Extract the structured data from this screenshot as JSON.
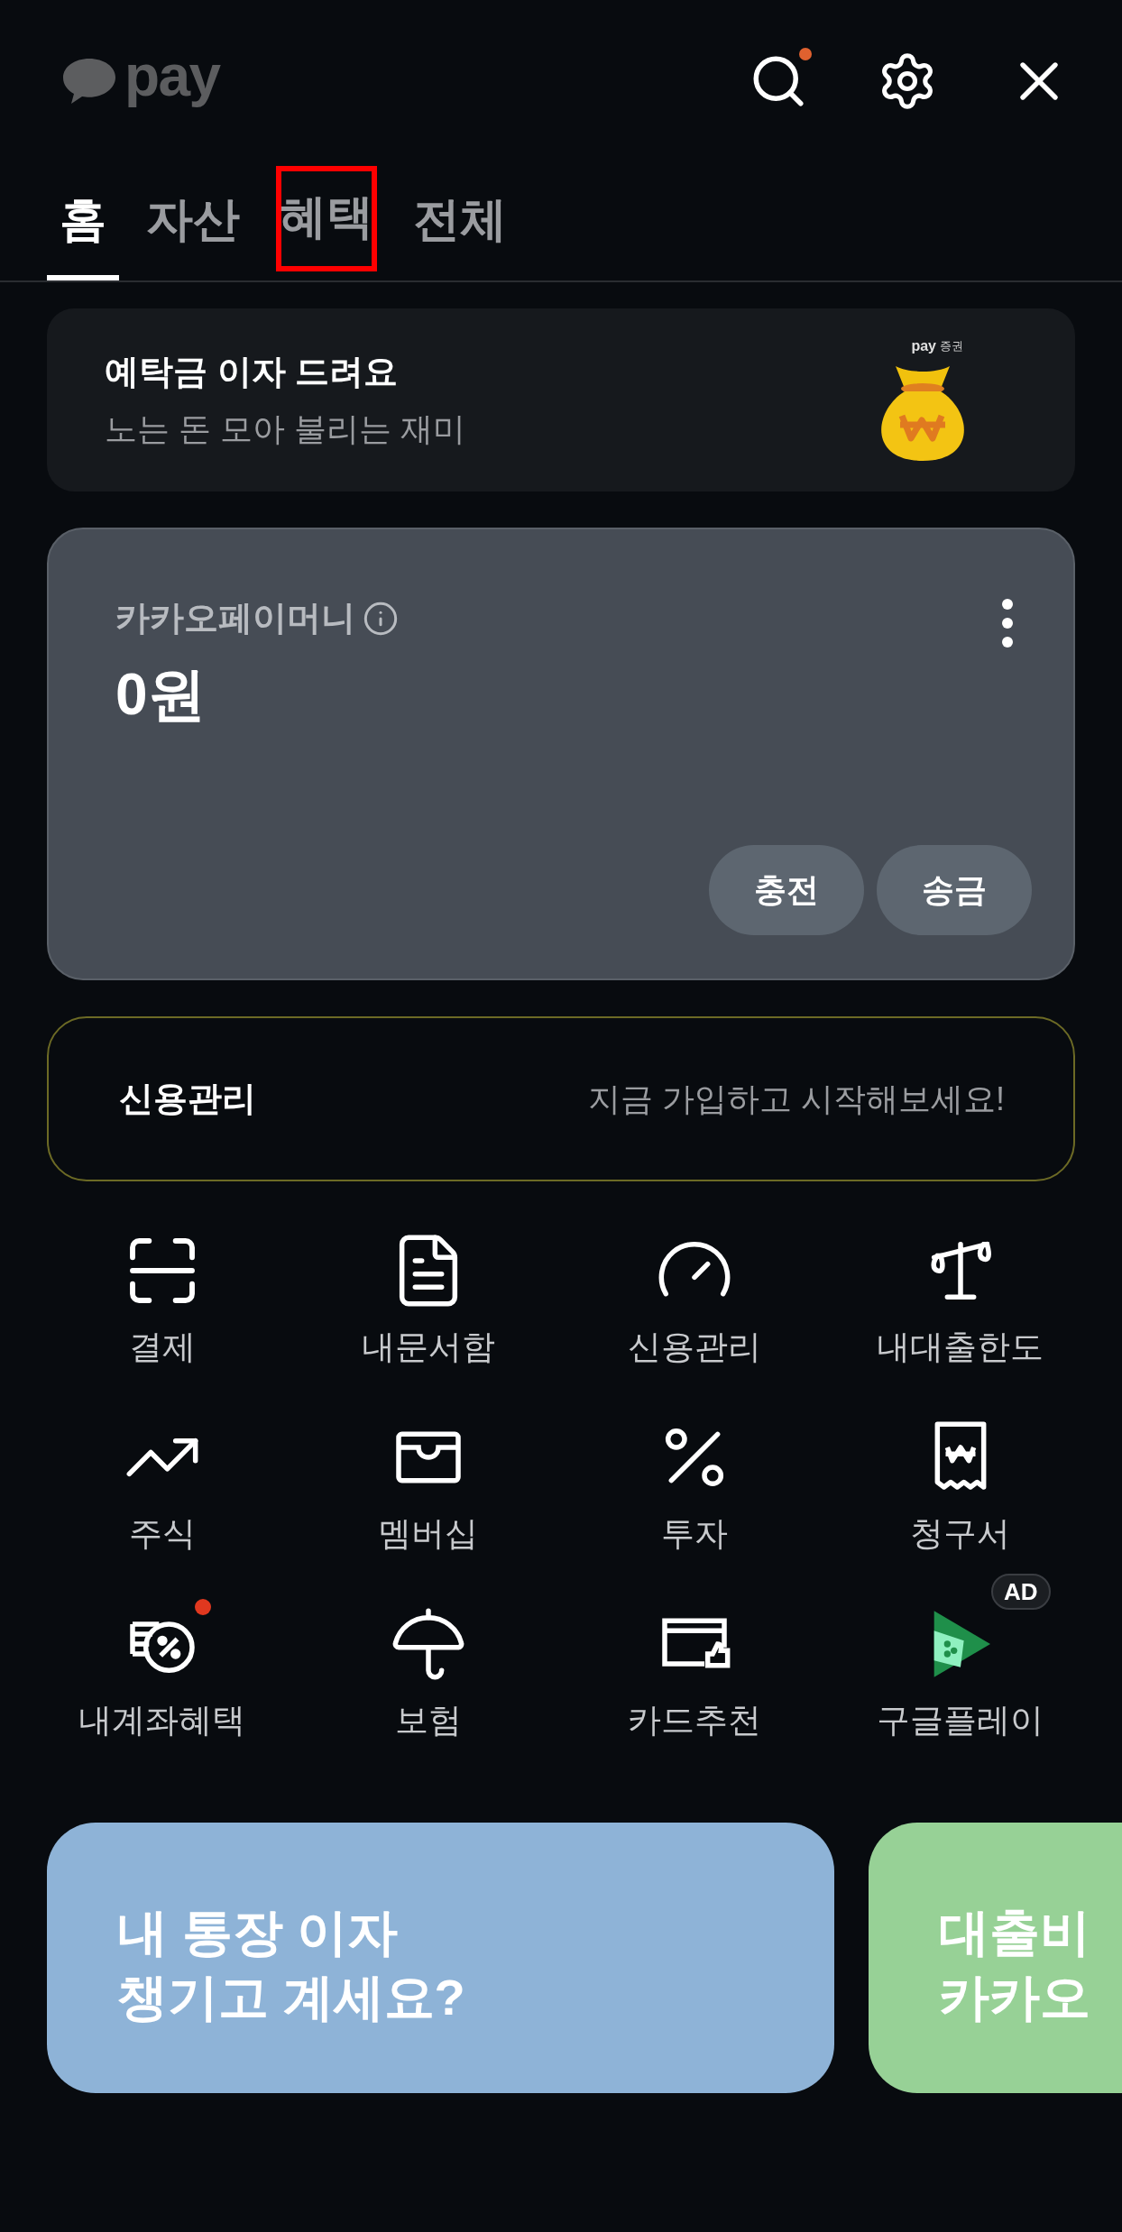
{
  "header": {
    "logo_text": "pay",
    "search_dot": true
  },
  "tabs": [
    {
      "label": "홈",
      "selected": true,
      "highlighted": false
    },
    {
      "label": "자산",
      "selected": false,
      "highlighted": false
    },
    {
      "label": "혜택",
      "selected": false,
      "highlighted": true
    },
    {
      "label": "전체",
      "selected": false,
      "highlighted": false
    }
  ],
  "banner": {
    "title": "예탁금 이자 드려요",
    "subtitle": "노는 돈 모아 불리는 재미",
    "brand": "pay",
    "brand_suffix": "증권"
  },
  "money_card": {
    "label": "카카오페이머니",
    "balance": "0원",
    "buttons": [
      "충전",
      "송금"
    ]
  },
  "credit": {
    "title": "신용관리",
    "hint": "지금 가입하고 시작해보세요!"
  },
  "menu": [
    {
      "label": "결제",
      "dot": false
    },
    {
      "label": "내문서함",
      "dot": false
    },
    {
      "label": "신용관리",
      "dot": false
    },
    {
      "label": "내대출한도",
      "dot": false
    },
    {
      "label": "주식",
      "dot": false
    },
    {
      "label": "멤버십",
      "dot": false
    },
    {
      "label": "투자",
      "dot": false
    },
    {
      "label": "청구서",
      "dot": false
    },
    {
      "label": "내계좌혜택",
      "dot": true
    },
    {
      "label": "보험",
      "dot": false
    },
    {
      "label": "카드추천",
      "dot": false
    },
    {
      "label": "구글플레이",
      "dot": false,
      "badge": "AD"
    }
  ],
  "promo_cards": [
    {
      "lines": [
        "내 통장 이자",
        "챙기고 계세요?"
      ],
      "color": "#8eb3d7"
    },
    {
      "lines": [
        "대출비",
        "카카오"
      ],
      "color": "#97d196"
    }
  ]
}
